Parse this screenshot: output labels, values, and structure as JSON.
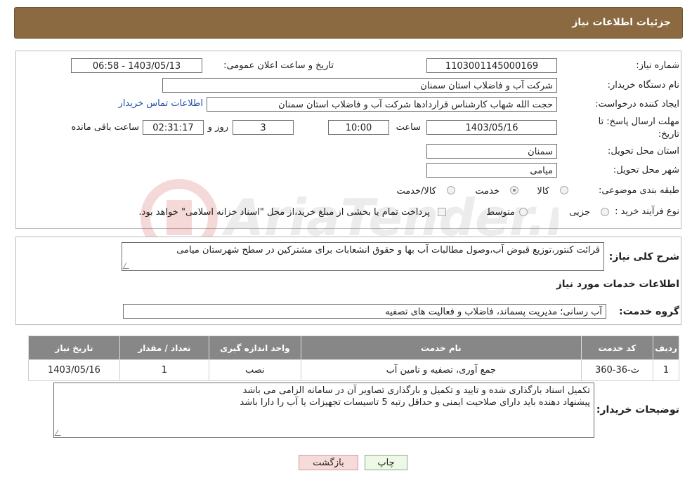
{
  "header": {
    "title": "جزئیات اطلاعات نیاز"
  },
  "info": {
    "need_number_label": "شماره نیاز:",
    "need_number": "1103001145000169",
    "announce_label": "تاریخ و ساعت اعلان عمومی:",
    "announce_value": "1403/05/13 - 06:58",
    "buyer_org_label": "نام دستگاه خریدار:",
    "buyer_org": "شرکت آب و فاضلاب استان سمنان",
    "creator_label": "ایجاد کننده درخواست:",
    "creator": "حجت الله شهاب کارشناس قراردادها شرکت آب و فاضلاب استان سمنان",
    "contact_link": "اطلاعات تماس خریدار",
    "deadline_label": "مهلت ارسال پاسخ: تا تاریخ:",
    "deadline_date": "1403/05/16",
    "time_label": "ساعت",
    "deadline_time": "10:00",
    "days_value": "3",
    "days_label": "روز و",
    "remaining_time": "02:31:17",
    "remaining_label": "ساعت باقی مانده",
    "province_label": "استان محل تحویل:",
    "province": "سمنان",
    "city_label": "شهر محل تحویل:",
    "city": "میامی",
    "category_label": "طبقه بندی موضوعی:",
    "category_options": [
      "کالا",
      "خدمت",
      "کالا/خدمت"
    ],
    "category_selected": "خدمت",
    "process_label": "نوع فرآیند خرید :",
    "process_options": [
      "جزیی",
      "متوسط"
    ],
    "payment_text": "پرداخت تمام یا بخشی از مبلغ خرید،از محل \"اسناد خزانه اسلامی\" خواهد بود."
  },
  "summary": {
    "label": "شرح کلی نیاز:",
    "text": "قرائت کنتور،توزیع قبوض آب،وصول مطالبات آب بها و حقوق انشعابات برای مشترکین در سطح شهرستان میامی"
  },
  "services": {
    "section_title": "اطلاعات خدمات مورد نیاز",
    "group_label": "گروه خدمت:",
    "group_value": "آب رسانی؛ مدیریت پسماند، فاضلاب و فعالیت های تصفیه",
    "columns": [
      "ردیف",
      "کد خدمت",
      "نام خدمت",
      "واحد اندازه گیری",
      "تعداد / مقدار",
      "تاریخ نیاز"
    ],
    "rows": [
      {
        "row": "1",
        "code": "ث-36-360",
        "name": "جمع آوری، تصفیه و تامین آب",
        "unit": "نصب",
        "qty": "1",
        "date": "1403/05/16"
      }
    ]
  },
  "buyer_notes": {
    "label": "توضیحات خریدار:",
    "lines": [
      "تکمیل اسناد  بارگذاری شده و تایید و تکمیل و  بارگذاری تصاویر آن در سامانه الزامی می باشد",
      "پیشنهاد دهنده باید دارای صلاحیت ایمنی و حداقل رتبه 5 تاسیسات تجهیزات یا آب را دارا باشد"
    ]
  },
  "buttons": {
    "print": "چاپ",
    "back": "بازگشت"
  },
  "colors": {
    "header_bg": "#8b6a42",
    "table_header_bg": "#878787",
    "link": "#1f4fa8",
    "print_bg": "#eef8e6",
    "back_bg": "#f7dada"
  },
  "watermark": {
    "text": "AriaTender.neT"
  }
}
